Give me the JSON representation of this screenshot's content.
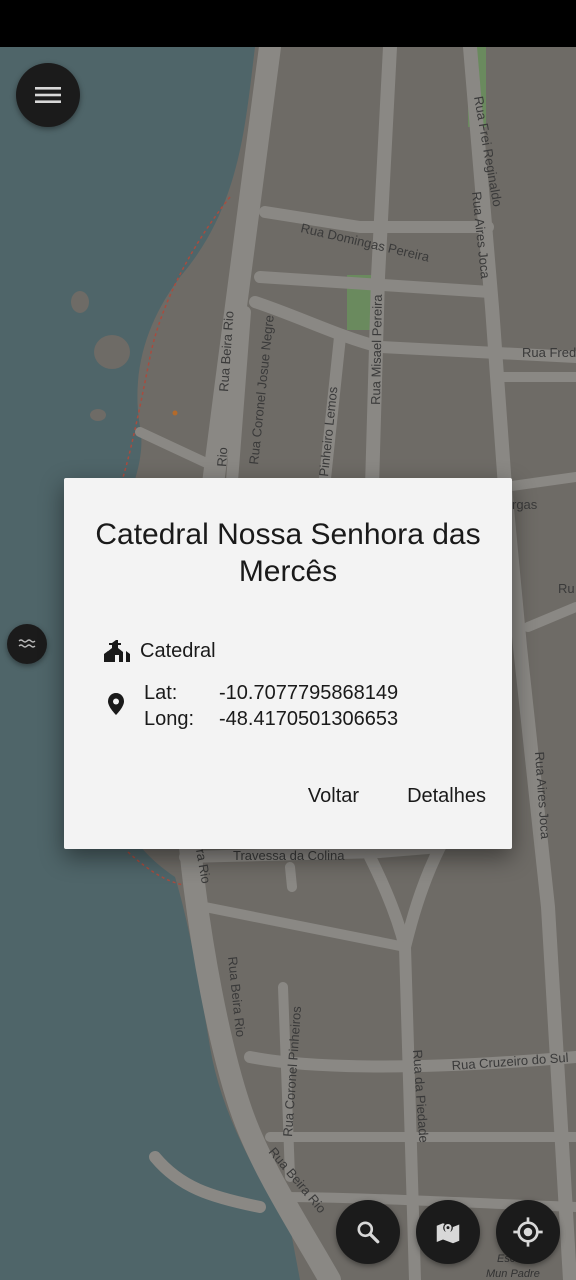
{
  "map": {
    "streets": [
      "Rua Frei Reginaldo",
      "Rua Domingas Pereira",
      "Rua Aires Joca",
      "Rua Beira Rio",
      "Rua Coronel Josue Negre",
      "Rua Misael Pereira",
      "Rua Fred",
      "Pinheiro Lemos",
      "Rio",
      "rgas",
      "Ru",
      "Travessa da Colina",
      "Rua Aires Joca",
      "ra Rio",
      "Rua Beira Rio",
      "Rua Coronel Pinheiros",
      "Rua da Piedade",
      "Rua Cruzeiro do Sul",
      "Rua Beira Rio",
      "Esc",
      "Mun Padre"
    ]
  },
  "buttons": {
    "menu_icon": "menu-icon",
    "water_icon": "water-icon",
    "search_icon": "search-icon",
    "maps_icon": "map-icon",
    "locate_icon": "gps-fixed-icon"
  },
  "dialog": {
    "title": "Catedral Nossa Senhora das Mercês",
    "type_icon": "church-icon",
    "type": "Catedral",
    "location_icon": "place-icon",
    "lat_label": "Lat:",
    "lat_value": "-10.7077795868149",
    "long_label": "Long:",
    "long_value": "-48.4170501306653",
    "back_button": "Voltar",
    "details_button": "Detalhes"
  },
  "colors": {
    "dialog_background": "#f3f3f3",
    "fab_background": "#1b1b1b",
    "water": "#4f6569",
    "land": "#6e6b66",
    "road": "#8a8884"
  }
}
